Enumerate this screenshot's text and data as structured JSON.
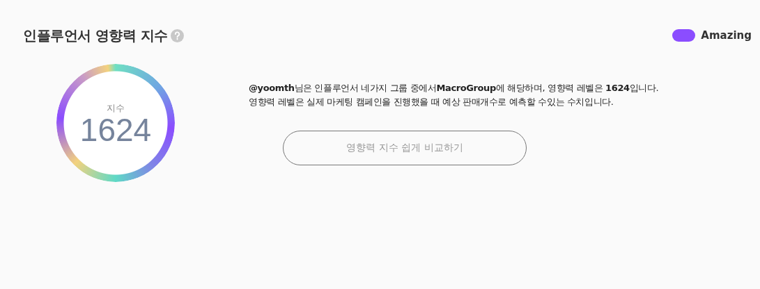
{
  "title": "인플루언서 영향력 지수",
  "legend": [
    {
      "label": "Amazing",
      "color": "#8b4dff"
    }
  ],
  "gauge": {
    "label": "지수",
    "value": "1624"
  },
  "description": [
    "**@yoomth**님은 인플루언서 네가지 그룹 중에서**MacroGroup**에 해당하며, 영향력 레벨은 **1624**입니다.",
    "영향력 레벨은 실제 마케팅 캠페인을 진행했을 때 예상 판매개수로 예측할 수있는 수치입니다."
  ],
  "compare_button": "영향력 지수 쉽게 비교하기"
}
